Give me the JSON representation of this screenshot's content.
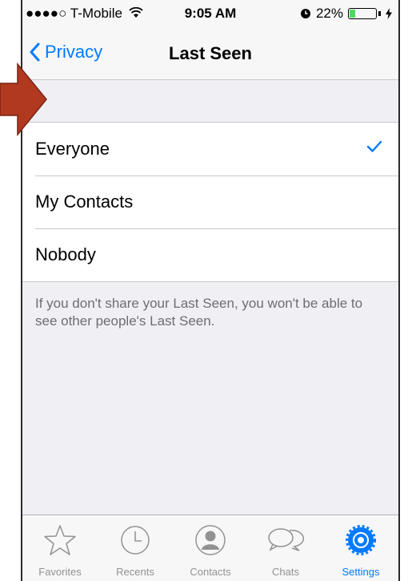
{
  "status_bar": {
    "carrier": "●●●●○ T-Mobile",
    "time": "9:05 AM",
    "battery": "22%",
    "battery_level": 0.22
  },
  "nav": {
    "back_label": "Privacy",
    "title": "Last Seen"
  },
  "options": [
    {
      "label": "Everyone",
      "selected": true
    },
    {
      "label": "My Contacts",
      "selected": false
    },
    {
      "label": "Nobody",
      "selected": false
    }
  ],
  "footnote": "If you don't share your Last Seen, you won't be able to see other people's Last Seen.",
  "tabs": [
    {
      "label": "Favorites",
      "icon": "star-icon"
    },
    {
      "label": "Recents",
      "icon": "clock-icon"
    },
    {
      "label": "Contacts",
      "icon": "person-icon"
    },
    {
      "label": "Chats",
      "icon": "chat-bubbles-icon"
    },
    {
      "label": "Settings",
      "icon": "gear-icon",
      "active": true
    }
  ],
  "colors": {
    "accent": "#007aff",
    "annotation_arrow": "#b0391f",
    "battery_fill": "#4cd964"
  }
}
